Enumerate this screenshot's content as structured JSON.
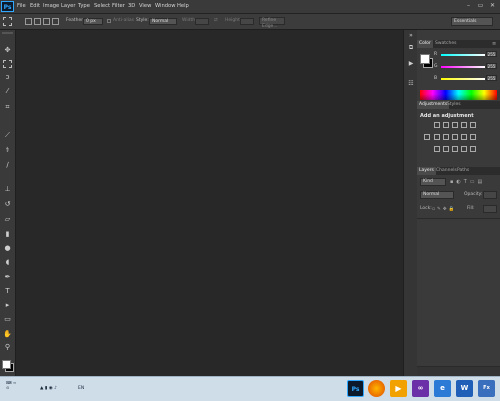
{
  "app": {
    "logo_text": "Ps",
    "menu": [
      "File",
      "Edit",
      "Image",
      "Layer",
      "Type",
      "Select",
      "Filter",
      "3D",
      "View",
      "Window",
      "Help"
    ],
    "window_controls": [
      "minimize-icon",
      "restore-icon",
      "close-icon"
    ]
  },
  "options_bar": {
    "feather_label": "Feather:",
    "feather_value": "0 px",
    "antialias_label": "Anti-alias",
    "style_label": "Style:",
    "style_value": "Normal",
    "width_label": "Width:",
    "height_label": "Height:",
    "refine_edge": "Refine Edge...",
    "workspace": "Essentials"
  },
  "tools": [
    "move-tool-icon",
    "marquee-tool-icon",
    "lasso-tool-icon",
    "quick-select-tool-icon",
    "crop-tool-icon",
    "eyedropper-tool-icon",
    "healing-brush-tool-icon",
    "brush-tool-icon",
    "clone-stamp-tool-icon",
    "history-brush-tool-icon",
    "eraser-tool-icon",
    "gradient-tool-icon",
    "blur-tool-icon",
    "dodge-tool-icon",
    "pen-tool-icon",
    "type-tool-icon",
    "path-select-tool-icon",
    "shape-tool-icon",
    "hand-tool-icon",
    "zoom-tool-icon"
  ],
  "color_panel": {
    "tabs": [
      "Color",
      "Swatches"
    ],
    "channels": [
      {
        "label": "R",
        "value": "255",
        "color": "#ff3c3c"
      },
      {
        "label": "G",
        "value": "255",
        "color": "#3cff3c"
      },
      {
        "label": "B",
        "value": "255",
        "color": "#3c7dff"
      }
    ],
    "foreground": "#ffffff",
    "background": "#000000"
  },
  "adjustments_panel": {
    "tabs": [
      "Adjustments",
      "Styles"
    ],
    "heading": "Add an adjustment"
  },
  "layers_panel": {
    "tabs": [
      "Layers",
      "Channels",
      "Paths"
    ],
    "kind_label": "Kind",
    "blend_mode": "Normal",
    "opacity_label": "Opacity:",
    "lock_label": "Lock:",
    "fill_label": "Fill:"
  },
  "taskbar": {
    "apps": [
      "Ps",
      "Firefox",
      "Media",
      "VS",
      "IE",
      "Word",
      "Fx"
    ],
    "tray_text": "EN"
  }
}
